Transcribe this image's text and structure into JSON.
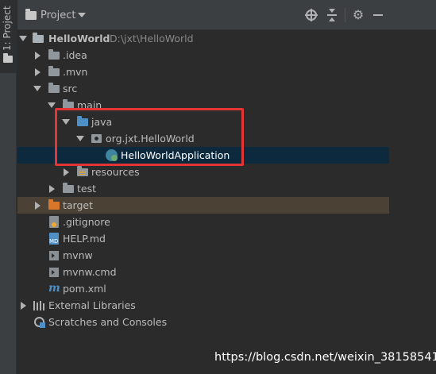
{
  "side_strip": {
    "label": "1: Project"
  },
  "header": {
    "title": "Project"
  },
  "tree": {
    "rows": [
      {
        "label": "HelloWorld",
        "secondary": "D:\\jxt\\HelloWorld"
      },
      {
        "label": ".idea"
      },
      {
        "label": ".mvn"
      },
      {
        "label": "src"
      },
      {
        "label": "main"
      },
      {
        "label": "java"
      },
      {
        "label": "org.jxt.HelloWorld"
      },
      {
        "label": "HelloWorldApplication"
      },
      {
        "label": "resources"
      },
      {
        "label": "test"
      },
      {
        "label": "target"
      },
      {
        "label": ".gitignore"
      },
      {
        "label": "HELP.md"
      },
      {
        "label": "mvnw"
      },
      {
        "label": "mvnw.cmd"
      },
      {
        "label": "pom.xml"
      },
      {
        "label": "External Libraries"
      },
      {
        "label": "Scratches and Consoles"
      }
    ]
  },
  "watermark": "https://blog.csdn.net/weixin_38158541",
  "colors": {
    "background": "#2b2b2b",
    "selection": "#0d293e",
    "excluded": "#4b4235",
    "highlight": "#e53434",
    "source_folder": "#4e8fc6"
  },
  "icons": [
    "project-folder-icon",
    "target-icon",
    "collapse-all-icon",
    "gear-icon",
    "minimize-icon",
    "folder-icon",
    "source-folder-icon",
    "package-icon",
    "spring-boot-class-icon",
    "resources-folder-icon",
    "excluded-folder-icon",
    "git-file-icon",
    "markdown-file-icon",
    "shell-file-icon",
    "maven-icon",
    "libraries-icon",
    "scratches-icon"
  ]
}
